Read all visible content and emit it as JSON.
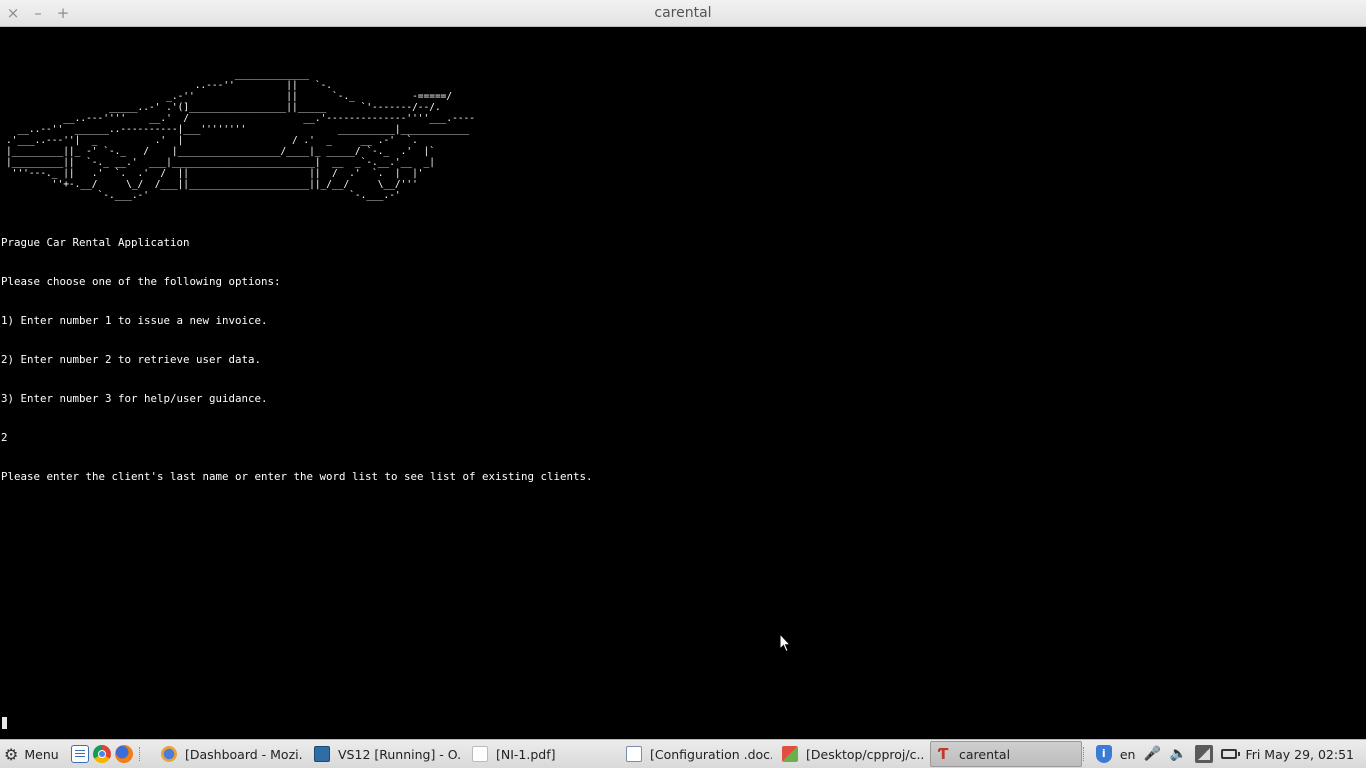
{
  "window": {
    "title": "carental",
    "close_glyph": "×",
    "minimize_glyph": "–",
    "maximize_glyph": "+"
  },
  "terminal": {
    "ascii_car": "                                        _____________\n                                 ..---''         ||   `-.\n                            _.-''                ||      `-._          -=====/\n                  _____..-' .'(]_________________||_____      `'-------/--/.\n          __..---''''    __.'  /                    __.'--------------''''___.----\n  __..--''  ______..----------|___''''''''                __________|____________\n.'___..---''|  _          .'  |                   / .'  _     __ .-'  `.\n|_________||_ -' `-._   /    |__________________/____|_ _____/ `-._  .'  |`\n|_________||  `-._ __.'  ___|_________________________|  __  _`-.__.'__  _|\n '''---._ ||   .'  `.  .'  /  ||                     ||  /  .'  `.  |  |'\n        ''+-.__/     \\_/  /___||_____________________||_/__/     \\__/'''\n                `-.___.-'                                   `-.___.-'",
    "lines": [
      "Prague Car Rental Application",
      "Please choose one of the following options:",
      "1) Enter number 1 to issue a new invoice.",
      "2) Enter number 2 to retrieve user data.",
      "3) Enter number 3 for help/user guidance.",
      "2",
      "Please enter the client's last name or enter the word list to see list of existing clients."
    ],
    "foreground": "#ffffff",
    "background": "#000000"
  },
  "taskbar": {
    "menu_label": "Menu",
    "launchers": [
      "text-editor-icon",
      "chrome-icon",
      "firefox-icon"
    ],
    "tasks": [
      {
        "label": "[Dashboard - Mozi...",
        "icon": "mozilla-icon"
      },
      {
        "label": "VS12 [Running] - O...",
        "icon": "virtualbox-icon"
      },
      {
        "label": "[NI-1.pdf]",
        "icon": "pdf-icon"
      },
      {
        "label": "[Configuration .doc...",
        "icon": "document-icon"
      },
      {
        "label": "[Desktop/cpproj/c...",
        "icon": "code-editor-icon"
      },
      {
        "label": "carental",
        "icon": "terminal-icon",
        "active": true
      }
    ],
    "keyboard_layout": "en",
    "clock": "Fri May 29, 02:51",
    "shield_glyph": "i"
  }
}
